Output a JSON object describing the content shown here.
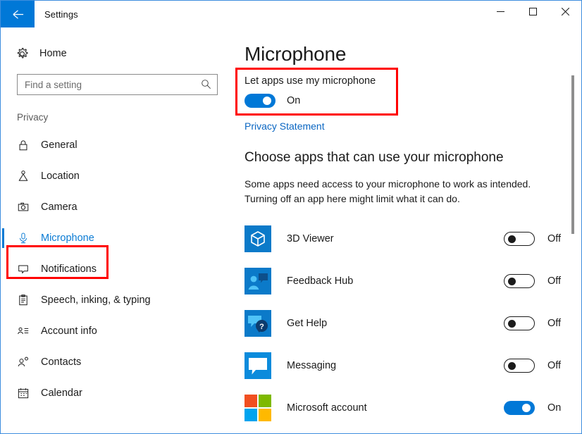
{
  "window": {
    "title": "Settings",
    "back_icon": "back-arrow-icon",
    "minimize_label": "─",
    "maximize_label": "☐",
    "close_label": "✕"
  },
  "sidebar": {
    "home_label": "Home",
    "home_icon": "gear-icon",
    "search": {
      "placeholder": "Find a setting",
      "value": "",
      "icon": "search-icon"
    },
    "group_label": "Privacy",
    "items": [
      {
        "label": "General",
        "icon": "lock-icon",
        "selected": false
      },
      {
        "label": "Location",
        "icon": "location-pin-icon",
        "selected": false
      },
      {
        "label": "Camera",
        "icon": "camera-icon",
        "selected": false
      },
      {
        "label": "Microphone",
        "icon": "microphone-icon",
        "selected": true
      },
      {
        "label": "Notifications",
        "icon": "speech-bubble-icon",
        "selected": false
      },
      {
        "label": "Speech, inking, & typing",
        "icon": "clipboard-icon",
        "selected": false
      },
      {
        "label": "Account info",
        "icon": "account-list-icon",
        "selected": false
      },
      {
        "label": "Contacts",
        "icon": "person-add-icon",
        "selected": false
      },
      {
        "label": "Calendar",
        "icon": "calendar-icon",
        "selected": false
      }
    ]
  },
  "main": {
    "page_title": "Microphone",
    "let_apps_label": "Let apps use my microphone",
    "let_apps_state": "On",
    "privacy_link": "Privacy Statement",
    "section_title": "Choose apps that can use your microphone",
    "section_desc": "Some apps need access to your microphone to work as intended. Turning off an app here might limit what it can do.",
    "apps": [
      {
        "name": "3D Viewer",
        "icon": "cube-icon",
        "state": "Off",
        "on": false
      },
      {
        "name": "Feedback Hub",
        "icon": "person-feedback-icon",
        "state": "Off",
        "on": false
      },
      {
        "name": "Get Help",
        "icon": "question-bubble-icon",
        "state": "Off",
        "on": false
      },
      {
        "name": "Messaging",
        "icon": "message-bubble-icon",
        "state": "Off",
        "on": false
      },
      {
        "name": "Microsoft account",
        "icon": "windows-logo-icon",
        "state": "On",
        "on": true
      }
    ]
  },
  "colors": {
    "accent": "#0078d7",
    "link": "#0a66c2",
    "annotation": "#ff0000",
    "selected_text": "#0a7bd4"
  }
}
